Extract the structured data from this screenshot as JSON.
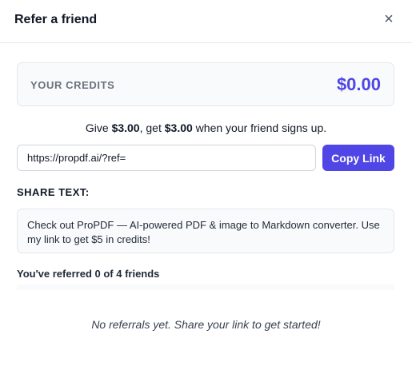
{
  "modal": {
    "title": "Refer a friend",
    "close_glyph": "×"
  },
  "credits": {
    "label": "YOUR CREDITS",
    "value": "$0.00"
  },
  "offer": {
    "prefix": "Give ",
    "give_amount": "$3.00",
    "middle": ", get ",
    "get_amount": "$3.00",
    "suffix": " when your friend signs up."
  },
  "link": {
    "value": "https://propdf.ai/?ref=",
    "copy_label": "Copy Link"
  },
  "share": {
    "heading": "SHARE TEXT:",
    "text": "Check out ProPDF — AI-powered PDF & image to Markdown converter. Use my link to get $5 in credits!"
  },
  "referrals": {
    "summary": "You've referred 0 of 4 friends",
    "empty_message": "No referrals yet. Share your link to get started!"
  },
  "colors": {
    "accent": "#4f46e5"
  }
}
